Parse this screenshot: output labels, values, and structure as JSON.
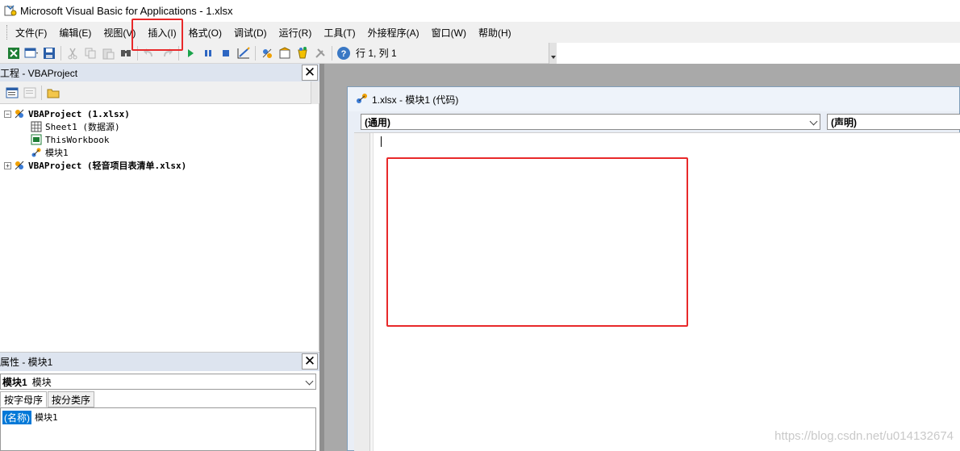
{
  "window": {
    "title": "Microsoft Visual Basic for Applications - 1.xlsx",
    "icon": "vba-app-icon"
  },
  "menubar": {
    "items": [
      {
        "label": "文件(F)"
      },
      {
        "label": "编辑(E)"
      },
      {
        "label": "视图(V)"
      },
      {
        "label": "插入(I)"
      },
      {
        "label": "格式(O)"
      },
      {
        "label": "调试(D)"
      },
      {
        "label": "运行(R)"
      },
      {
        "label": "工具(T)"
      },
      {
        "label": "外接程序(A)"
      },
      {
        "label": "窗口(W)"
      },
      {
        "label": "帮助(H)"
      }
    ],
    "highlighted": "插入(I)"
  },
  "toolbar": {
    "status": "行 1, 列 1",
    "icons": [
      "excel-view-icon",
      "insert-userform-icon",
      "save-icon",
      "cut-icon",
      "copy-icon",
      "paste-icon",
      "find-icon",
      "undo-icon",
      "redo-icon",
      "run-icon",
      "break-icon",
      "reset-icon",
      "design-mode-icon",
      "project-explorer-icon",
      "properties-icon",
      "object-browser-icon",
      "toolbox-icon",
      "help-icon"
    ]
  },
  "project_panel": {
    "title": "工程 - VBAProject",
    "tree": [
      {
        "label": "VBAProject (1.xlsx)",
        "level": 0,
        "expanded": true,
        "bold": true,
        "icon": "vbaproject-icon"
      },
      {
        "label": "Sheet1 (数据源)",
        "level": 1,
        "icon": "sheet-icon"
      },
      {
        "label": "ThisWorkbook",
        "level": 1,
        "icon": "workbook-icon"
      },
      {
        "label": "模块1",
        "level": 1,
        "icon": "module-icon"
      },
      {
        "label": "VBAProject (轻音项目表清单.xlsx)",
        "level": 0,
        "expanded": false,
        "bold": true,
        "icon": "vbaproject-icon"
      }
    ]
  },
  "properties_panel": {
    "title": "属性 - 模块1",
    "object_name": "模块1",
    "object_type": "模块",
    "tabs": [
      "按字母序",
      "按分类序"
    ],
    "active_tab": "按字母序",
    "rows": [
      {
        "key": "(名称)",
        "value": "模块1"
      }
    ]
  },
  "code_window": {
    "title": "1.xlsx - 模块1 (代码)",
    "object_combo": "(通用)",
    "proc_combo": "(声明)",
    "content": ""
  },
  "colors": {
    "highlight_red": "#e8292a",
    "panel_header": "#dde4ef",
    "mdi_background": "#a9a9a9"
  },
  "watermark": "https://blog.csdn.net/u014132674"
}
